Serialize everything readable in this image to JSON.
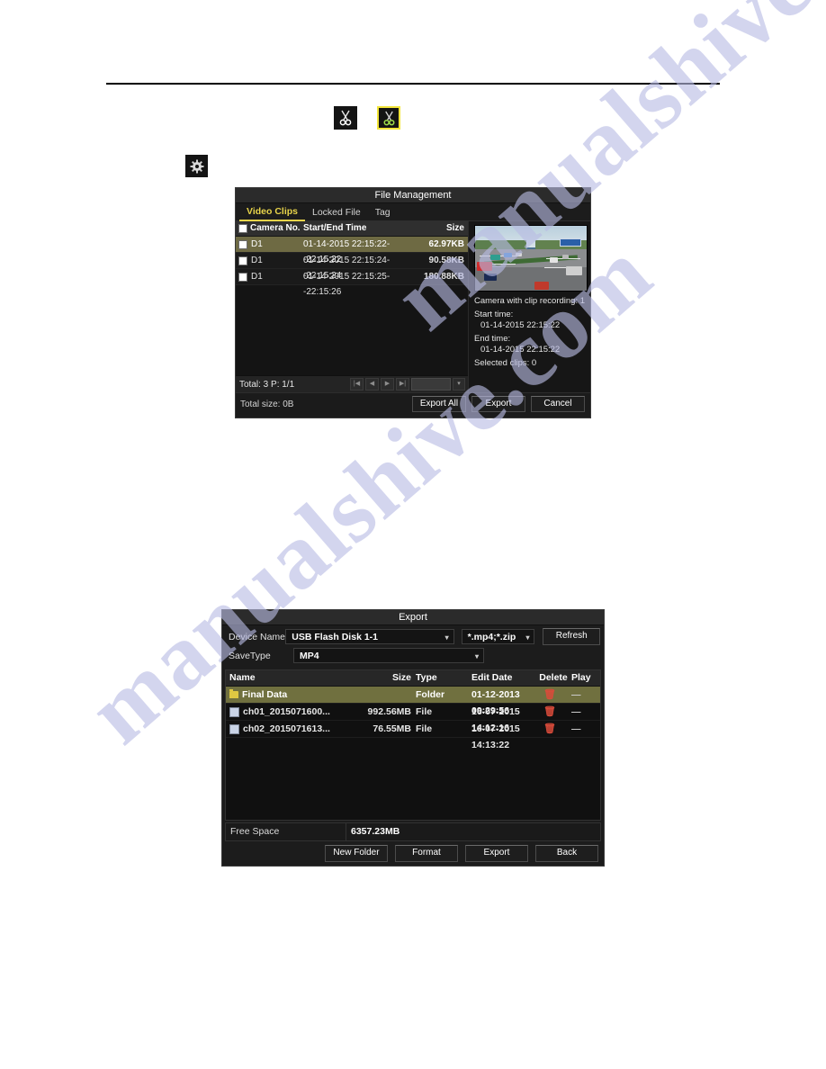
{
  "watermark": {
    "line1": "manualshive.com",
    "line2": "manualshive.com"
  },
  "toolbar_icons": {
    "scissors_normal": "scissors-icon",
    "scissors_active": "scissors-active-icon",
    "gear": "gear-icon"
  },
  "file_management": {
    "title": "File Management",
    "tabs": [
      {
        "label": "Video Clips",
        "active": true
      },
      {
        "label": "Locked File",
        "active": false
      },
      {
        "label": "Tag",
        "active": false
      }
    ],
    "columns": {
      "camera": "Camera No.",
      "time": "Start/End Time",
      "size": "Size"
    },
    "rows": [
      {
        "camera": "D1",
        "time": "01-14-2015 22:15:22--22:15:22",
        "size": "62.97KB",
        "selected": true
      },
      {
        "camera": "D1",
        "time": "01-14-2015 22:15:24--22:15:24",
        "size": "90.58KB",
        "selected": false
      },
      {
        "camera": "D1",
        "time": "01-14-2015 22:15:25--22:15:26",
        "size": "180.88KB",
        "selected": false
      }
    ],
    "pager": {
      "total": "Total: 3  P: 1/1",
      "first": "|◀",
      "prev": "◀",
      "next": "▶",
      "last": "▶|",
      "page_value": "",
      "go_caret": "▾"
    },
    "details": {
      "camera_with_clip": "Camera with clip recording: 1",
      "start_label": "Start time:",
      "start_value": "01-14-2015 22:15:22",
      "end_label": "End time:",
      "end_value": "01-14-2015 22:15:22",
      "selected_clips": "Selected clips: 0"
    },
    "footer": {
      "total_size": "Total size: 0B",
      "export_all": "Export All",
      "export": "Export",
      "cancel": "Cancel"
    }
  },
  "export_dialog": {
    "title": "Export",
    "device_label": "Device Name",
    "device_value": "USB Flash Disk 1-1",
    "filter_value": "*.mp4;*.zip",
    "refresh_label": "Refresh",
    "savetype_label": "SaveType",
    "savetype_value": "MP4",
    "columns": {
      "name": "Name",
      "size": "Size",
      "type": "Type",
      "edit_date": "Edit Date",
      "delete": "Delete",
      "play": "Play"
    },
    "files": [
      {
        "name": "Final Data",
        "size": "",
        "type": "Folder",
        "edit_date": "01-12-2013 09:29:56",
        "icon": "folder-icon",
        "delete": "🗑",
        "play": "—",
        "highlighted": true
      },
      {
        "name": "ch01_2015071600...",
        "size": "992.56MB",
        "type": "File",
        "edit_date": "16-07-2015 14:12:16",
        "icon": "file-icon",
        "delete": "🗑",
        "play": "—",
        "highlighted": false
      },
      {
        "name": "ch02_2015071613...",
        "size": "76.55MB",
        "type": "File",
        "edit_date": "16-07-2015 14:13:22",
        "icon": "file-icon",
        "delete": "🗑",
        "play": "—",
        "highlighted": false
      }
    ],
    "free_space_label": "Free Space",
    "free_space_value": "6357.23MB",
    "buttons": {
      "new_folder": "New Folder",
      "format": "Format",
      "export": "Export",
      "back": "Back"
    }
  },
  "colors": {
    "accent_yellow": "#e8d44a",
    "row_highlight": "#6e6a43",
    "folder_highlight": "#70703f",
    "delete_red": "#d94b3a",
    "dialog_bg": "#1c1c1c"
  }
}
